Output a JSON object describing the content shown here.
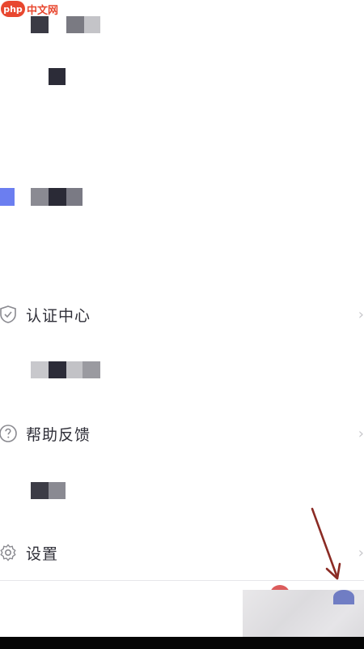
{
  "watermark": {
    "logo_text": "php",
    "site_text": "中文网"
  },
  "menu": {
    "items": [
      {
        "label": "认证中心",
        "icon": "shield-check-icon",
        "chevron": "›"
      },
      {
        "label": "帮助反馈",
        "icon": "question-circle-icon",
        "chevron": "›"
      },
      {
        "label": "设置",
        "icon": "gear-icon",
        "chevron": "›"
      }
    ]
  },
  "annotation": {
    "arrow_color": "#8b2b24"
  },
  "colors": {
    "accent": "#6b7ef0",
    "badge": "#d84a4a",
    "watermark": "#e8472f"
  }
}
